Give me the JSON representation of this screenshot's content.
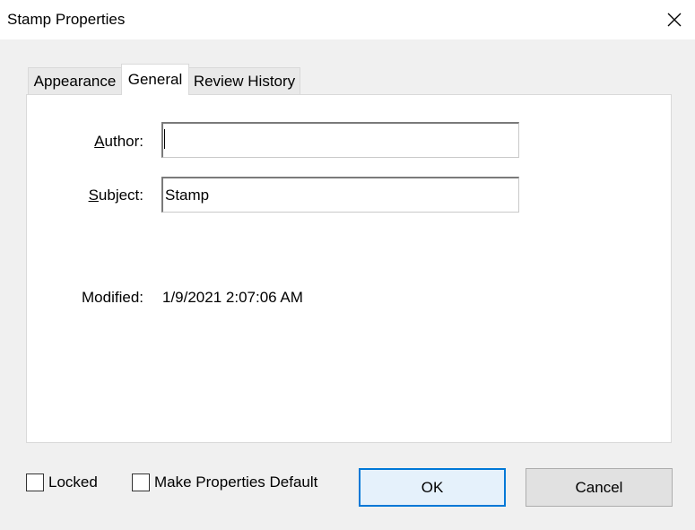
{
  "window": {
    "title": "Stamp Properties",
    "close_icon": "close-icon"
  },
  "tabs": [
    {
      "label": "Appearance",
      "active": false
    },
    {
      "label": "General",
      "active": true
    },
    {
      "label": "Review History",
      "active": false
    }
  ],
  "general": {
    "author": {
      "label_prefix": "A",
      "label_rest": "uthor:",
      "value": ""
    },
    "subject": {
      "label_prefix": "S",
      "label_rest": "ubject:",
      "value": "Stamp"
    },
    "modified": {
      "label": "Modified:",
      "value": "1/9/2021 2:07:06 AM"
    }
  },
  "footer": {
    "locked_label": "Locked",
    "locked_checked": false,
    "make_default_label": "Make Properties Default",
    "make_default_checked": false,
    "ok_label": "OK",
    "cancel_label": "Cancel"
  },
  "colors": {
    "accent": "#0078d7",
    "window_bg": "#f0f0f0"
  }
}
